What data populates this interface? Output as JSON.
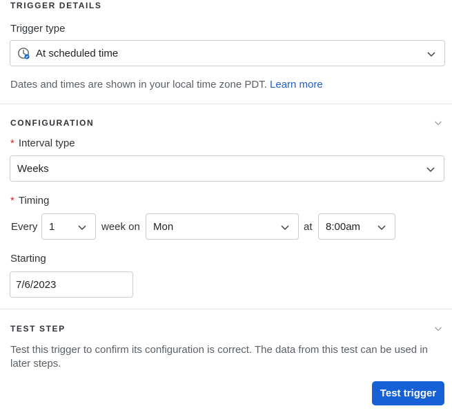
{
  "trigger_details": {
    "heading": "TRIGGER DETAILS",
    "trigger_type_label": "Trigger type",
    "trigger_type_value": "At scheduled time",
    "timezone_hint": "Dates and times are shown in your local time zone PDT.",
    "learn_more": "Learn more"
  },
  "configuration": {
    "heading": "CONFIGURATION",
    "interval_label": "Interval type",
    "interval_value": "Weeks",
    "timing_label": "Timing",
    "every_text": "Every",
    "every_value": "1",
    "week_on_text": "week on",
    "day_value": "Mon",
    "at_text": "at",
    "time_value": "8:00am",
    "starting_label": "Starting",
    "starting_value": "7/6/2023",
    "required_marker": "*"
  },
  "test_step": {
    "heading": "TEST STEP",
    "description": "Test this trigger to confirm its configuration is correct. The data from this test can be used in later steps.",
    "button_label": "Test trigger"
  },
  "colors": {
    "accent": "#1660d6",
    "link": "#1d5fc8",
    "required": "#d6202e"
  }
}
